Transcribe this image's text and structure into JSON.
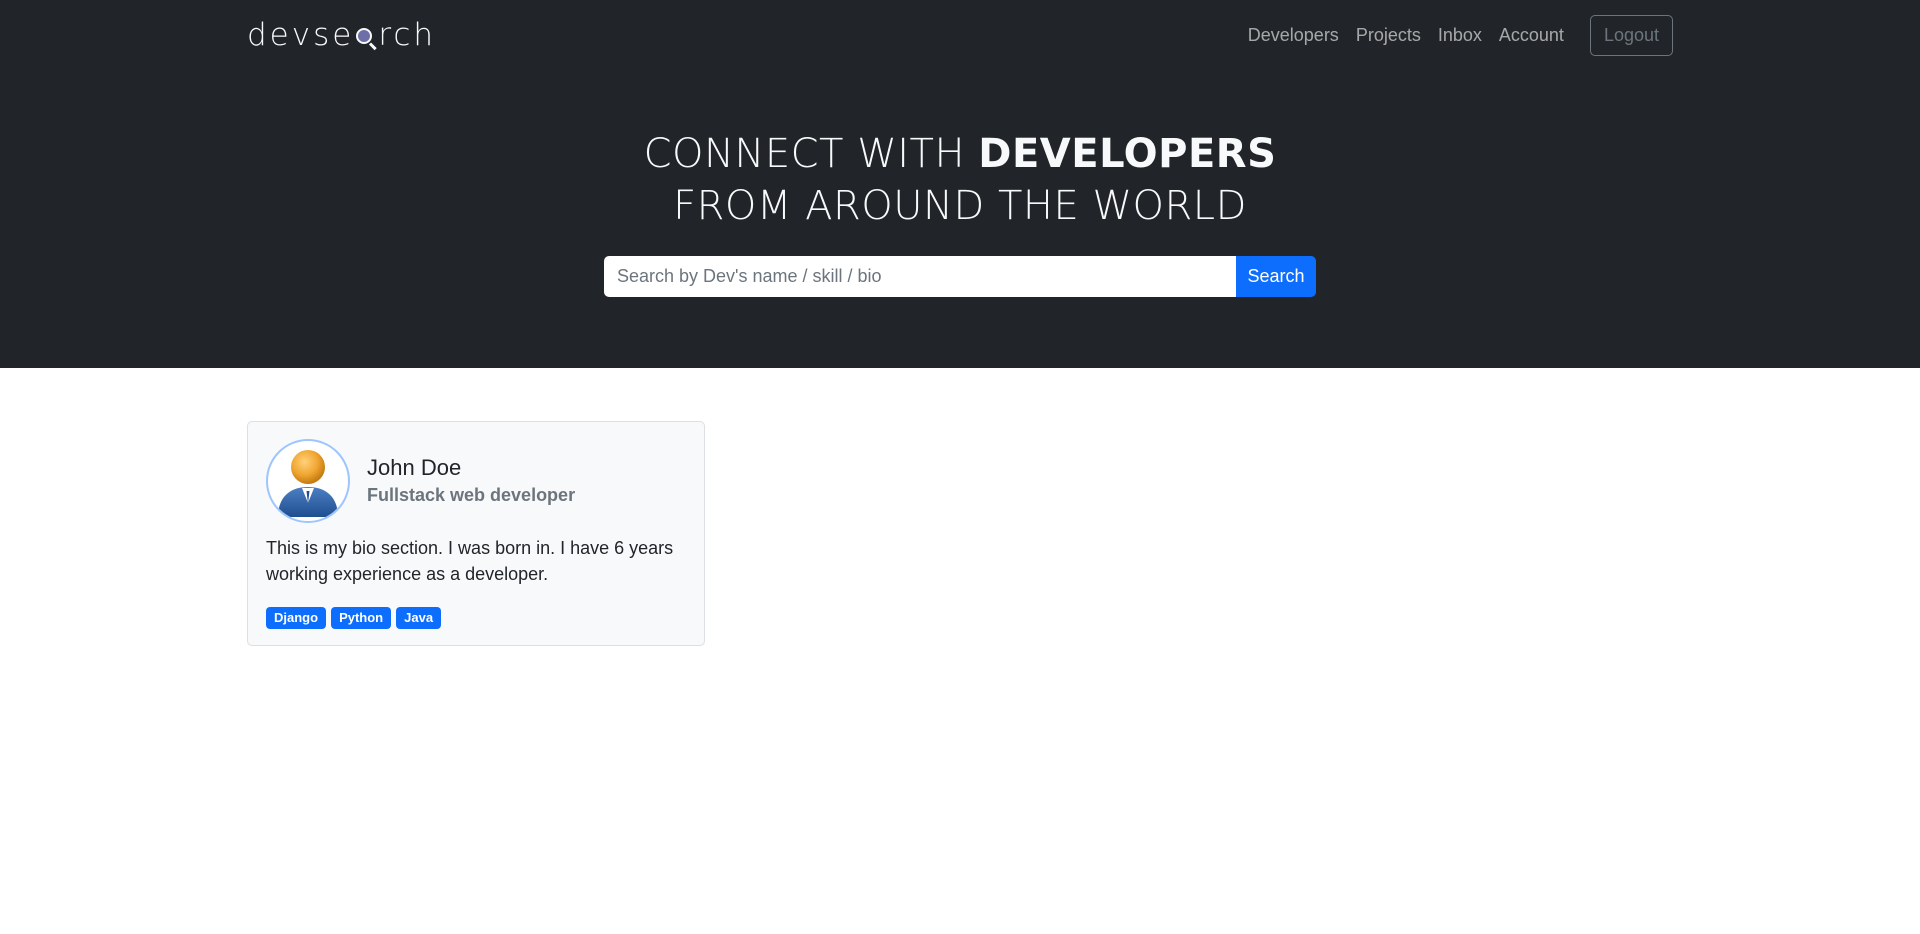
{
  "brand": {
    "prefix": "devse",
    "suffix": "rch",
    "icon": "magnifier-icon"
  },
  "nav": {
    "items": [
      {
        "label": "Developers"
      },
      {
        "label": "Projects"
      },
      {
        "label": "Inbox"
      },
      {
        "label": "Account"
      }
    ],
    "logout_label": "Logout"
  },
  "hero": {
    "line1_light": "CONNECT WITH ",
    "line1_bold": "DEVELOPERS",
    "line2": "FROM AROUND THE WORLD"
  },
  "search": {
    "placeholder": "Search by Dev's name / skill / bio",
    "value": "",
    "button_label": "Search"
  },
  "developers": [
    {
      "name": "John Doe",
      "title": "Fullstack web developer",
      "bio": "This is my bio section. I was born in. I have 6 years working experience as a developer.",
      "avatar_icon": "user-avatar-icon",
      "skills": [
        "Django",
        "Python",
        "Java"
      ]
    }
  ],
  "colors": {
    "header_bg": "#212529",
    "primary": "#0d6efd",
    "card_bg": "#f8f9fa",
    "muted": "#6c757d"
  }
}
